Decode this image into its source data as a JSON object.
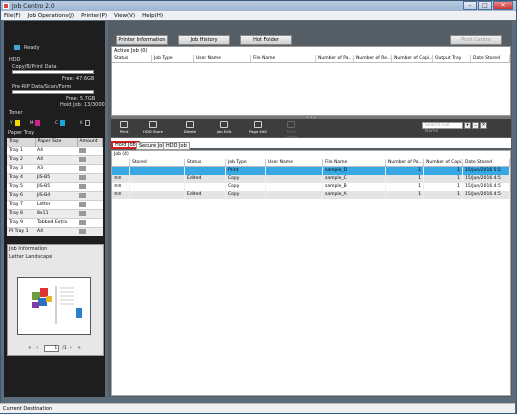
{
  "window": {
    "title": "Job Centro 2.0",
    "min": "–",
    "max": "□",
    "close": "✕"
  },
  "menu": [
    "File(F)",
    "Job Operations(J)",
    "Printer(P)",
    "View(V)",
    "Help(H)"
  ],
  "status": {
    "ready": "Ready",
    "hdd_label": "HDD",
    "hdd_copy": "Copy/B/Print Data",
    "hdd_copy_free": "Free: 47.6GB",
    "hdd_scan": "Pre-RIP Data/Scan/Form",
    "hdd_scan_free": "Free: 5.7GB",
    "hold_jobs": "Hold Job: 13/3000",
    "toner_label": "Toner",
    "toner_letters": [
      "Y",
      "M",
      "C",
      "K"
    ],
    "toner_colors": [
      "#f1d800",
      "#d0208a",
      "#18a5d8",
      "#222222"
    ]
  },
  "paper_tray": {
    "title": "Paper Tray",
    "headers": [
      "Tray",
      "Paper Size",
      "Amount"
    ],
    "rows": [
      [
        "Tray 1",
        "A4"
      ],
      [
        "Tray 2",
        "A4"
      ],
      [
        "Tray 3",
        "A3"
      ],
      [
        "Tray 4",
        "JIS-B5"
      ],
      [
        "Tray 5",
        "JIS-B5"
      ],
      [
        "Tray 6",
        "JIS-B4"
      ],
      [
        "Tray 7",
        "Letter"
      ],
      [
        "Tray 8",
        "8x11"
      ],
      [
        "Tray 9",
        "Tabbed Extra"
      ],
      [
        "PI Tray 1",
        "A4"
      ]
    ]
  },
  "job_info": {
    "title": "Job Information",
    "subtitle": "Letter Landscape",
    "page_value": "1",
    "page_total": "/1"
  },
  "top_buttons": [
    "Printer Information",
    "Job History",
    "Hot Folder",
    "Print Centro"
  ],
  "active_job": {
    "title": "Active Job (0)",
    "headers": [
      "Status",
      "Job Type",
      "User Name",
      "File Name",
      "Number of Pa...",
      "Number of Re...",
      "Number of Copi...",
      "Output Tray",
      "Date Stored"
    ]
  },
  "toolbar": [
    "Print",
    "HDD Store",
    "Delete",
    "Job Edit",
    "Page Edit",
    "Print Centro"
  ],
  "search": {
    "placeholder": "Search File Name",
    "go": "▾",
    "close": "✕",
    "down": "⌄"
  },
  "tabs": [
    "Hold Job",
    "Secure Job",
    "HDD Job"
  ],
  "hold_job": {
    "count": "Job (4)",
    "headers": [
      "",
      "Stored",
      "Status",
      "Job Type",
      "User Name",
      "File Name",
      "Number of Pa...",
      "Number of Copi...",
      "Date Stored"
    ],
    "rows": [
      {
        "icon": "",
        "stored": "",
        "status": "",
        "type": "Print",
        "user": "",
        "file": "sample_D",
        "pages": "1",
        "copies": "1",
        "date": "15/Jun/2016 5:5"
      },
      {
        "icon": "≡≡",
        "stored": "",
        "status": "Edited",
        "type": "Copy",
        "user": "",
        "file": "sample_C",
        "pages": "1",
        "copies": "1",
        "date": "15/Jun/2016 4:5"
      },
      {
        "icon": "≡≡",
        "stored": "",
        "status": "",
        "type": "Copy",
        "user": "",
        "file": "sample_B",
        "pages": "1",
        "copies": "1",
        "date": "15/Jun/2016 4:5"
      },
      {
        "icon": "≡≡",
        "stored": "",
        "status": "Edited",
        "type": "Copy",
        "user": "",
        "file": "sample_A",
        "pages": "1",
        "copies": "1",
        "date": "15/Jun/2016 4:5"
      }
    ]
  },
  "statusbar": "Current Destination"
}
